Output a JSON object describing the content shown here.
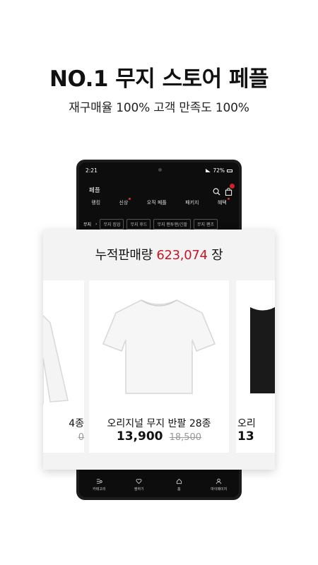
{
  "headline": "NO.1 무지 스토어 페플",
  "subline": "재구매율 100% 고객 만족도 100%",
  "phone": {
    "status": {
      "time": "2:21",
      "battery": "72%"
    },
    "app_title": "페플",
    "nav": [
      {
        "label": "랭킹",
        "new": false
      },
      {
        "label": "신상",
        "new": true
      },
      {
        "label": "오직 페플",
        "new": false
      },
      {
        "label": "패키지",
        "new": false
      },
      {
        "label": "혜택",
        "new": true
      }
    ],
    "category": {
      "current": "무지",
      "chips": [
        "무지 집업",
        "무지 후드",
        "무지 맨투맨/긴팔",
        "무지 팬츠"
      ]
    },
    "bottom_nav": [
      "카테고리",
      "찜하기",
      "홈",
      "마이페이지"
    ]
  },
  "promo": {
    "label": "누적판매량",
    "value": "623,07",
    "value_fragment": "4",
    "unit": "장"
  },
  "products": [
    {
      "name": "4종",
      "price": "",
      "orig": "0"
    },
    {
      "name": "오리지널 무지 반팔 28종",
      "price": "13,900",
      "orig": "18,500"
    },
    {
      "name": "오리",
      "price": "13",
      "orig": ""
    }
  ],
  "colors": {
    "accent": "#c51825",
    "dark": "#0d0d0d"
  },
  "icons": [
    "search-icon",
    "shopping-bag-icon",
    "chevron-right-icon",
    "category-icon",
    "heart-icon",
    "home-icon",
    "user-icon"
  ]
}
